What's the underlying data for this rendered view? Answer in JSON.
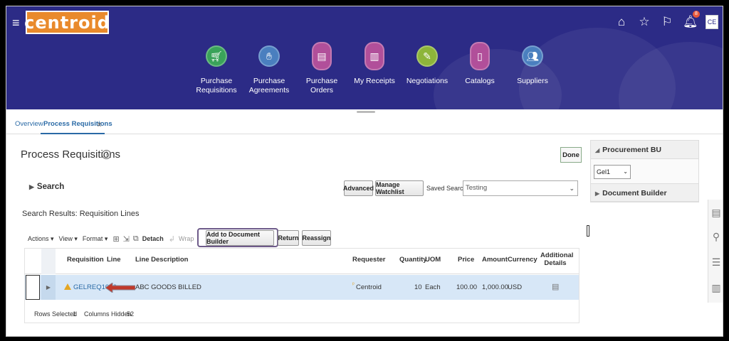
{
  "header": {
    "brand": "CENTROID",
    "avatar_initials": "CE",
    "notification_count": "8",
    "nav": [
      {
        "label": "Purchase Requisitions",
        "color": "#3aa35a"
      },
      {
        "label": "Purchase Agreements",
        "color": "#4a7fbf"
      },
      {
        "label": "Purchase Orders",
        "color": "#b14f9a"
      },
      {
        "label": "My Receipts",
        "color": "#b14f9a"
      },
      {
        "label": "Negotiations",
        "color": "#8db53a"
      },
      {
        "label": "Catalogs",
        "color": "#b14f9a"
      },
      {
        "label": "Suppliers",
        "color": "#4a7fbf"
      }
    ]
  },
  "tabs": {
    "overview": "Overview",
    "process": "Process Requisitions",
    "close": "x"
  },
  "page": {
    "title": "Process Requisitions",
    "help": "?",
    "done": "Done",
    "search": "Search",
    "advanced": "Advanced",
    "manage_watchlist": "Manage Watchlist",
    "saved_search_label": "Saved Search",
    "saved_search_value": "Testing",
    "results_label": "Search Results: Requisition Lines"
  },
  "toolbar": {
    "actions": "Actions ▾",
    "view": "View ▾",
    "format": "Format ▾",
    "detach": "Detach",
    "wrap": "Wrap",
    "add_to_doc_builder": "Add to Document Builder",
    "return": "Return",
    "reassign": "Reassign"
  },
  "table": {
    "headers": {
      "requisition": "Requisition",
      "line": "Line",
      "line_description": "Line Description",
      "requester": "Requester",
      "quantity": "Quantity",
      "uom": "UOM",
      "price": "Price",
      "amount": "Amount",
      "currency": "Currency",
      "additional_details": "Additional Details"
    },
    "rows": [
      {
        "requisition": "GELREQ1016",
        "line": "",
        "line_description": "ABC GOODS BILLED",
        "requester": "Centroid",
        "quantity": "10",
        "uom": "Each",
        "price": "100.00",
        "amount": "1,000.00",
        "currency": "USD"
      }
    ],
    "rows_selected_label": "Rows Selected",
    "rows_selected_value": "1",
    "columns_hidden_label": "Columns Hidden",
    "columns_hidden_value": "52"
  },
  "right_panel": {
    "procurement_bu": "Procurement BU",
    "bu_value": "Gel1",
    "document_builder": "Document Builder"
  },
  "colors": {
    "header_bg": "#2c2b86",
    "logo_bg": "#e98a2c",
    "link": "#2a6aa6",
    "row_selected": "#d7e7f7",
    "callout_arrow": "#c0392b",
    "highlight_border": "#6e5b8a"
  }
}
